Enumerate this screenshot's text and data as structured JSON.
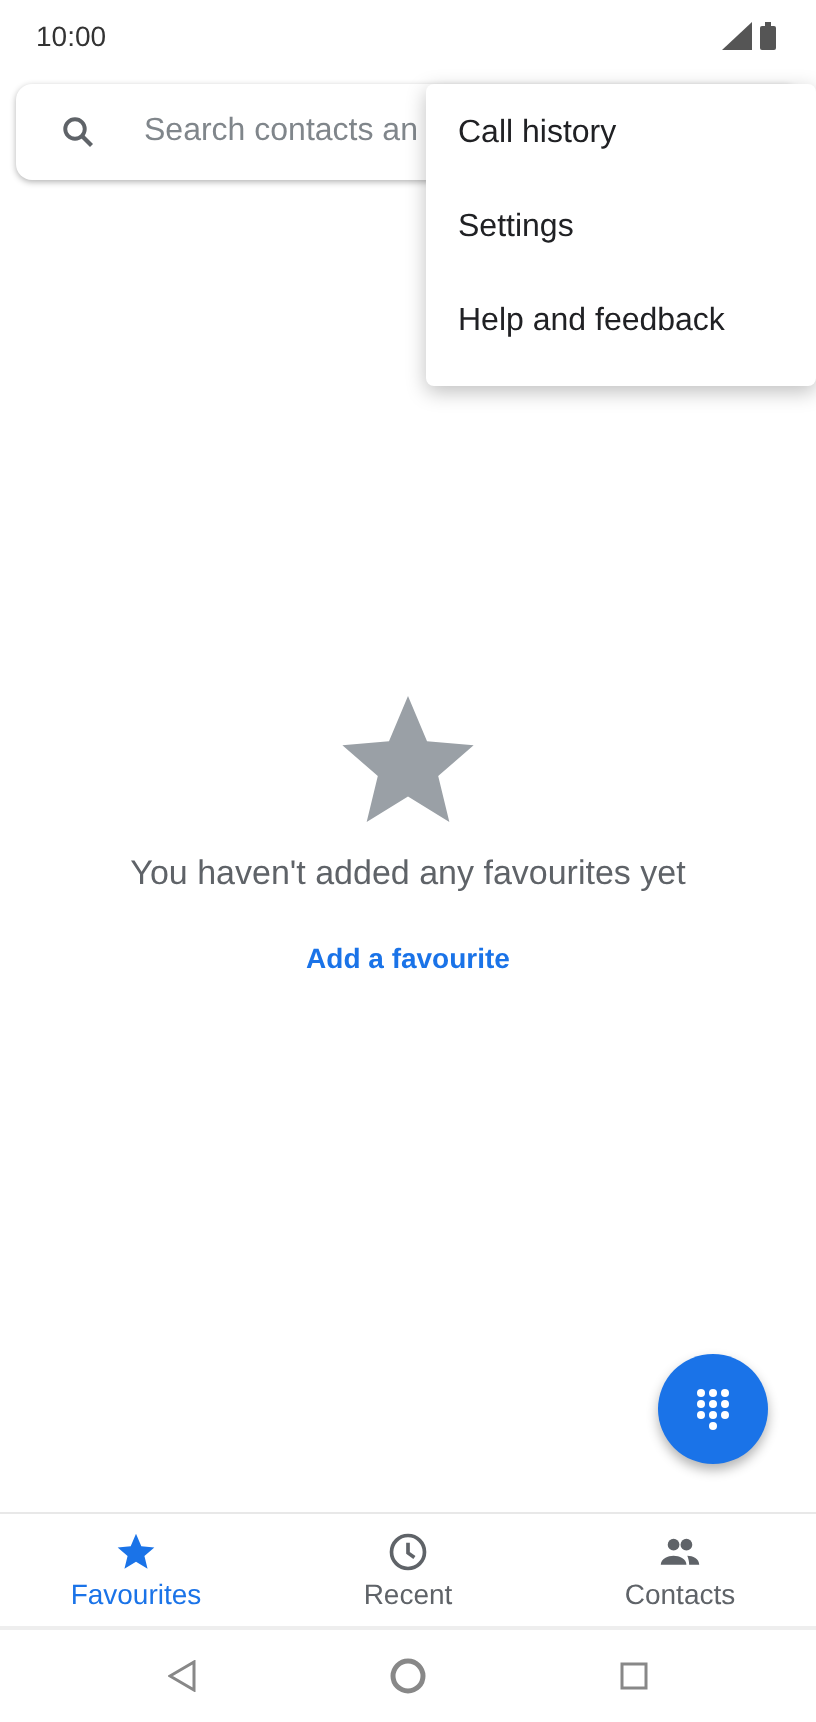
{
  "status_bar": {
    "time": "10:00"
  },
  "search": {
    "placeholder": "Search contacts an"
  },
  "menu": {
    "items": [
      {
        "label": "Call history"
      },
      {
        "label": "Settings"
      },
      {
        "label": "Help and feedback"
      }
    ]
  },
  "empty_state": {
    "message": "You haven't added any favourites yet",
    "action": "Add a favourite"
  },
  "bottom_nav": {
    "tabs": [
      {
        "label": "Favourites",
        "kind": "star",
        "selected": true
      },
      {
        "label": "Recent",
        "kind": "clock",
        "selected": false
      },
      {
        "label": "Contacts",
        "kind": "people",
        "selected": false
      }
    ]
  }
}
